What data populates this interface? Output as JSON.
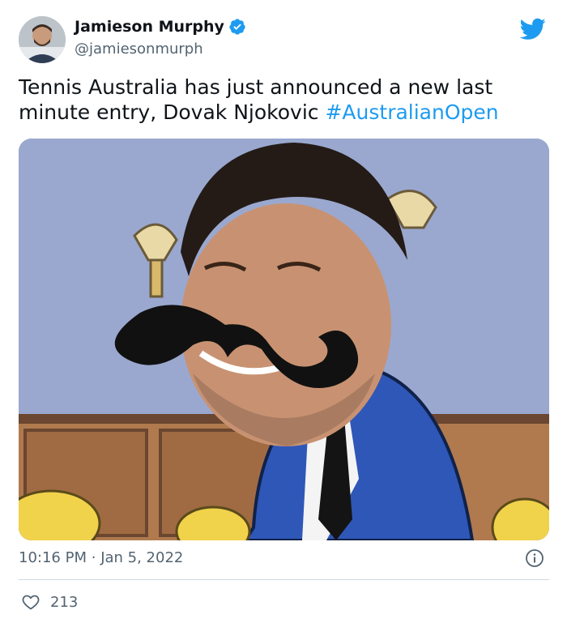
{
  "author": {
    "name": "Jamieson Murphy",
    "handle": "@jamiesonmurph",
    "verified": true
  },
  "tweet": {
    "text": "Tennis Australia has just announced a new last minute entry, Dovak Njokovic",
    "hashtag": "#AustralianOpen"
  },
  "meta": {
    "time": "10:16 PM",
    "separator": "·",
    "date": "Jan 5, 2022"
  },
  "engagement": {
    "likes": "213"
  },
  "colors": {
    "accent": "#1d9bf0",
    "text": "#0f1419",
    "secondary": "#536471",
    "divider": "#cfd9de"
  },
  "icons": {
    "brand": "twitter-bird-icon",
    "verified": "verified-badge-icon",
    "info": "info-icon",
    "like": "heart-icon"
  }
}
